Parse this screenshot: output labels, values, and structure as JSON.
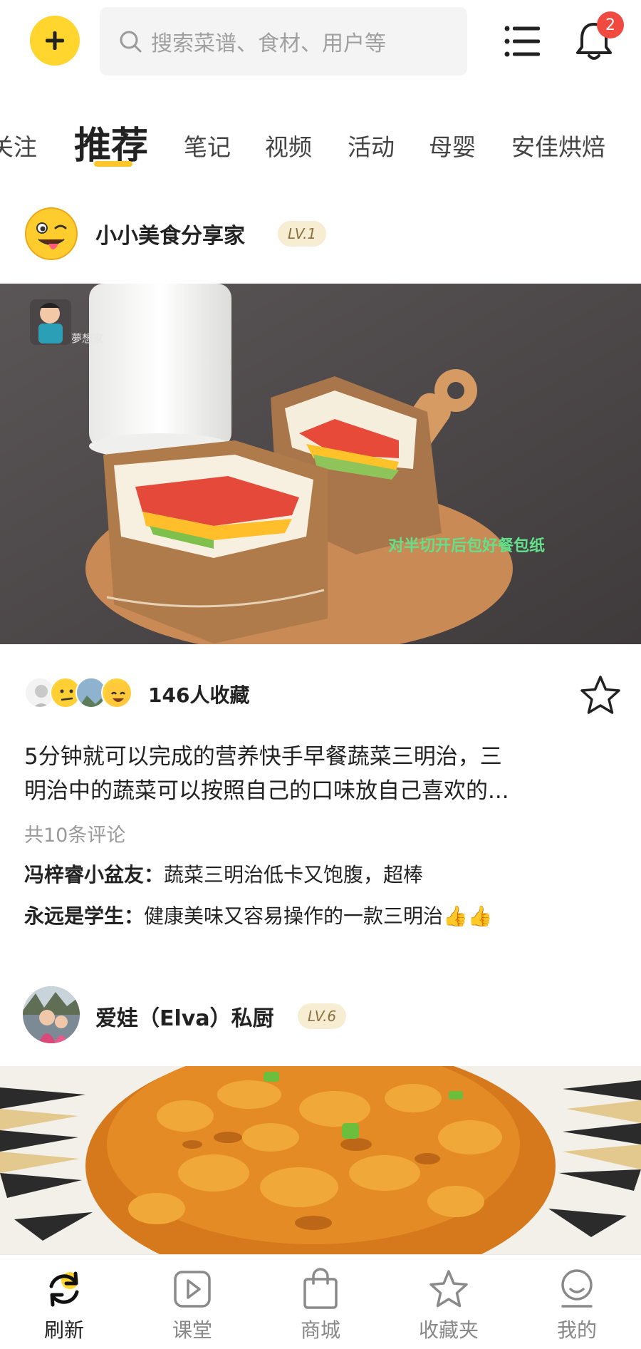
{
  "header": {
    "search_placeholder": "搜索菜谱、食材、用户等",
    "notification_count": "2"
  },
  "tabs": [
    "关注",
    "推荐",
    "笔记",
    "视频",
    "活动",
    "母婴",
    "安佳烘焙"
  ],
  "posts": [
    {
      "author": "小小美食分享家",
      "level": "LV.1",
      "image_watermark": "夢想家",
      "image_caption": "对半切开后包好餐包纸",
      "favorites": "146人收藏",
      "description_line1": "5分钟就可以完成的营养快手早餐蔬菜三明治，三",
      "description_line2": "明治中的蔬菜可以按照自己的口味放自己喜欢的...",
      "comment_count": "共10条评论",
      "comments": [
        {
          "user": "冯梓睿小盆友：",
          "text": "蔬菜三明治低卡又饱腹，超棒"
        },
        {
          "user": "永远是学生：",
          "text": "健康美味又容易操作的一款三明治👍👍"
        }
      ]
    },
    {
      "author": "爱娃（Elva）私厨",
      "level": "LV.6"
    }
  ],
  "bottom_nav": [
    {
      "label": "刷新",
      "icon": "refresh-icon"
    },
    {
      "label": "课堂",
      "icon": "play-icon"
    },
    {
      "label": "商城",
      "icon": "shopping-bag-icon"
    },
    {
      "label": "收藏夹",
      "icon": "star-icon"
    },
    {
      "label": "我的",
      "icon": "profile-icon"
    }
  ],
  "colors": {
    "accent": "#ffd52e",
    "badge": "#f04a40"
  }
}
